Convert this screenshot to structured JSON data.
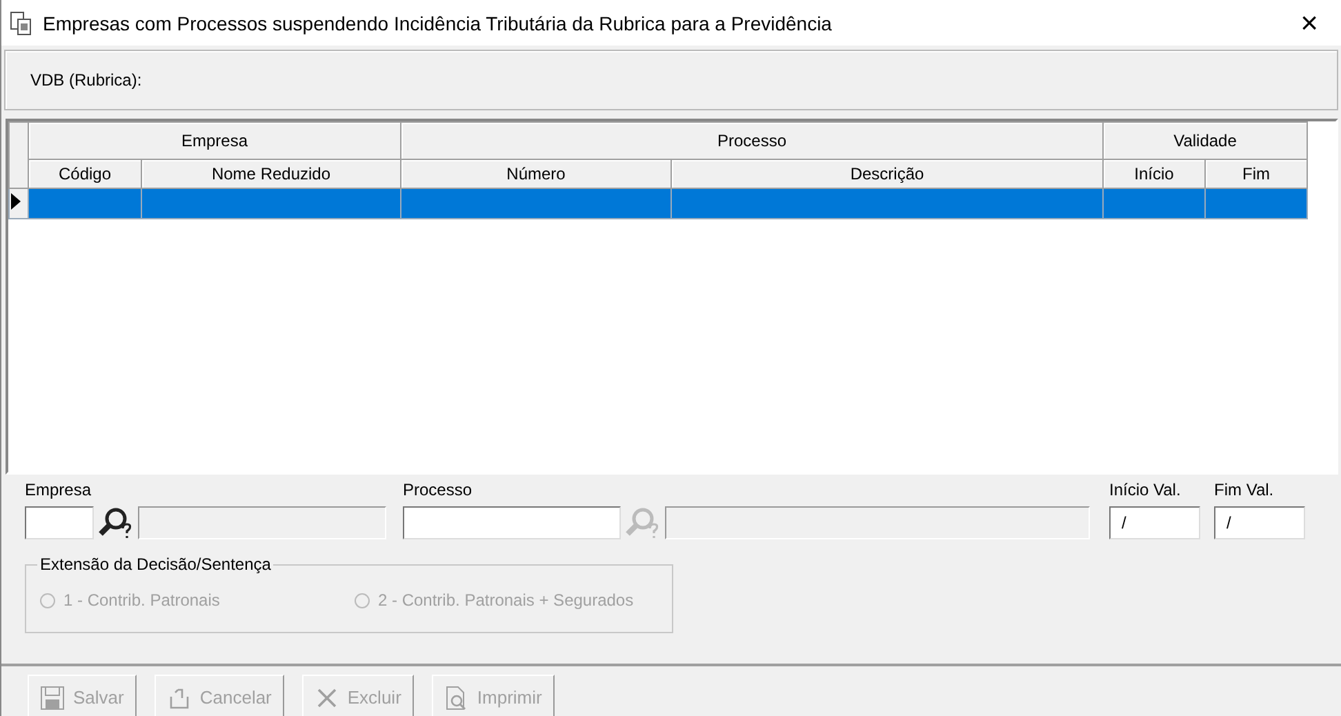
{
  "window": {
    "title": "Empresas com Processos suspendendo Incidência Tributária da Rubrica para a Previdência",
    "close": "×"
  },
  "header": {
    "label": "VDB (Rubrica):"
  },
  "grid": {
    "groups": [
      {
        "label": "Empresa",
        "columns": [
          "Código",
          "Nome Reduzido"
        ]
      },
      {
        "label": "Processo",
        "columns": [
          "Número",
          "Descrição"
        ]
      },
      {
        "label": "Validade",
        "columns": [
          "Início",
          "Fim"
        ]
      }
    ],
    "rows": [
      {
        "selected": true
      }
    ]
  },
  "form": {
    "empresa": {
      "label": "Empresa",
      "lookup_disabled": false
    },
    "processo": {
      "label": "Processo",
      "lookup_disabled": true
    },
    "inicio": {
      "label": "Início Val.",
      "value": "/"
    },
    "fim": {
      "label": "Fim Val.",
      "value": "/"
    },
    "extensao": {
      "legend": "Extensão da Decisão/Sentença",
      "options": [
        {
          "label": "1 - Contrib. Patronais",
          "selected": false,
          "disabled": true
        },
        {
          "label": "2 - Contrib. Patronais + Segurados",
          "selected": false,
          "disabled": true
        }
      ]
    }
  },
  "buttons": [
    {
      "kind": "save",
      "label": "Salvar",
      "disabled": true
    },
    {
      "kind": "cancel",
      "label": "Cancelar",
      "disabled": true
    },
    {
      "kind": "delete",
      "label": "Excluir",
      "disabled": true
    },
    {
      "kind": "print",
      "label": "Imprimir",
      "disabled": true
    }
  ]
}
